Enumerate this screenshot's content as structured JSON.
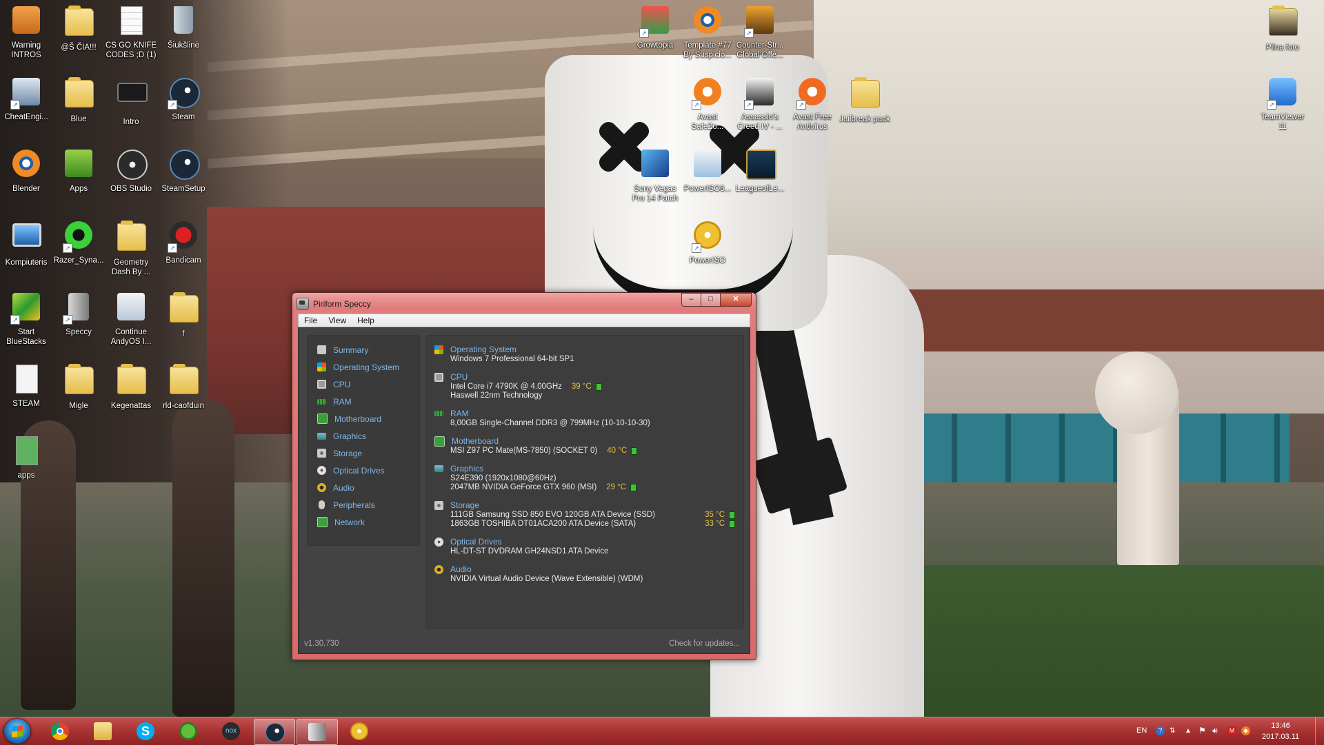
{
  "desktop_icons": {
    "warning_intros": "Warning INTROS",
    "s_cia": "@Š ČIA!!!",
    "csgo_knife": "CS GO KNIFE CODES ;D (1)",
    "siuksline": "Šiukšlinė",
    "cheatengine": "CheatEngi...",
    "blue": "Blue",
    "intro": "Intro",
    "steam": "Steam",
    "blender": "Blender",
    "apps": "Apps",
    "obs": "OBS Studio",
    "steamsetup": "SteamSetup",
    "kompiuteris": "Kompiuteris",
    "razer": "Razer_Syna...",
    "geometry": "Geometry Dash By ...",
    "bandicam": "Bandicam",
    "bluestacks": "Start BlueStacks",
    "speccy": "Speccy",
    "andyos": "Continue AndyOS I...",
    "f": "f",
    "steam_caps": "STEAM",
    "migle": "Migle",
    "kegenattas": "Kegenattas",
    "rld": "rld-caofduin",
    "apps_lower": "apps",
    "growtopia": "Growtopia",
    "template77": "Template #77 By Suspicio...",
    "csgo_offensive": "Counter-Str... Global Offe...",
    "avast_safezone": "Avast SafeZo...",
    "assassins": "Assassin's Creed IV - ...",
    "avast_free": "Avast Free Antivirus",
    "jailbreak": "Jailbreak pack",
    "sony_vegas": "Sony Vegas Pro 14 Patch",
    "poweriso6": "PowerISO6...",
    "league": "LeagueofLe...",
    "poweriso": "PowerISO",
    "pilna_foto": "Pilna foto",
    "teamviewer": "TeamViewer 11"
  },
  "window": {
    "title": "Piriform Speccy",
    "controls": {
      "minimize": "–",
      "maximize": "□",
      "close": "✕"
    },
    "menu": [
      "File",
      "View",
      "Help"
    ],
    "sidebar": [
      {
        "label": "Summary",
        "icon": "summary-icon",
        "color": "#c9c9c9"
      },
      {
        "label": "Operating System",
        "icon": "windows-icon",
        "color": "#3a8fd8"
      },
      {
        "label": "CPU",
        "icon": "cpu-icon",
        "color": "#9a9a9a"
      },
      {
        "label": "RAM",
        "icon": "ram-icon",
        "color": "#3aa03a"
      },
      {
        "label": "Motherboard",
        "icon": "motherboard-icon",
        "color": "#3aa03a"
      },
      {
        "label": "Graphics",
        "icon": "graphics-icon",
        "color": "#2f8a7a"
      },
      {
        "label": "Storage",
        "icon": "storage-icon",
        "color": "#9a9a9a"
      },
      {
        "label": "Optical Drives",
        "icon": "optical-drive-icon",
        "color": "#d8d8d8"
      },
      {
        "label": "Audio",
        "icon": "audio-icon",
        "color": "#d8b020"
      },
      {
        "label": "Peripherals",
        "icon": "peripherals-icon",
        "color": "#cfcfcf"
      },
      {
        "label": "Network",
        "icon": "network-icon",
        "color": "#3aa03a"
      }
    ],
    "sections": {
      "os": {
        "title": "Operating System",
        "line1": "Windows 7 Professional 64-bit SP1"
      },
      "cpu": {
        "title": "CPU",
        "line1": "Intel Core i7 4790K @ 4.00GHz",
        "temp1": "39 °C",
        "line2": "Haswell 22nm Technology"
      },
      "ram": {
        "title": "RAM",
        "line1": "8,00GB Single-Channel DDR3 @ 799MHz (10-10-10-30)"
      },
      "motherboard": {
        "title": "Motherboard",
        "line1": "MSI Z97 PC Mate(MS-7850) (SOCKET 0)",
        "temp1": "40 °C"
      },
      "graphics": {
        "title": "Graphics",
        "line1": "S24E390 (1920x1080@60Hz)",
        "line2": "2047MB NVIDIA GeForce GTX 960 (MSI)",
        "temp2": "29 °C"
      },
      "storage": {
        "title": "Storage",
        "line1": "111GB Samsung SSD 850 EVO 120GB ATA Device (SSD)",
        "temp1": "35 °C",
        "line2": "1863GB TOSHIBA DT01ACA200 ATA Device (SATA)",
        "temp2": "33 °C"
      },
      "optical": {
        "title": "Optical Drives",
        "line1": "HL-DT-ST DVDRAM GH24NSD1 ATA Device"
      },
      "audio": {
        "title": "Audio",
        "line1": "NVIDIA Virtual Audio Device (Wave Extensible) (WDM)"
      }
    },
    "status": {
      "version": "v1.30.730",
      "check_updates": "Check for updates..."
    }
  },
  "taskbar": {
    "items": [
      "start-button",
      "chrome-icon",
      "file-explorer-icon",
      "skype-icon",
      "minecraft-icon",
      "nox-icon",
      "steam-icon",
      "speccy-icon",
      "poweriso-icon"
    ],
    "nox_label": "nox",
    "tray": {
      "lang": "EN",
      "time": "13:46",
      "date": "2017.03.11"
    }
  }
}
